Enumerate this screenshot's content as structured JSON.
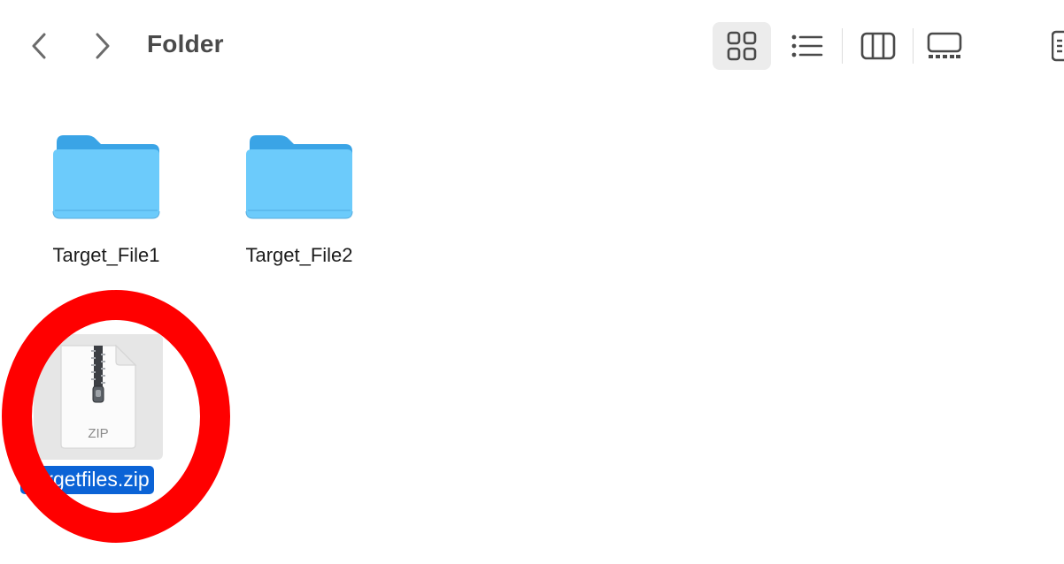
{
  "window": {
    "title": "Folder"
  },
  "toolbar": {
    "back_icon": "chevron-left-icon",
    "forward_icon": "chevron-right-icon",
    "view_modes": [
      {
        "name": "icons",
        "icon": "icon-grid-icon",
        "selected": true
      },
      {
        "name": "list",
        "icon": "list-icon",
        "selected": false
      },
      {
        "name": "columns",
        "icon": "columns-icon",
        "selected": false
      },
      {
        "name": "gallery",
        "icon": "gallery-icon",
        "selected": false
      }
    ]
  },
  "items": [
    {
      "name": "Target_File1",
      "kind": "folder",
      "icon": "folder-icon",
      "selected": false
    },
    {
      "name": "Target_File2",
      "kind": "folder",
      "icon": "folder-icon",
      "selected": false
    },
    {
      "name": "Targetfiles.zip",
      "kind": "zip",
      "icon": "zip-archive-icon",
      "badge": "ZIP",
      "selected": true
    }
  ],
  "colors": {
    "selection": "#0b63d6",
    "folder_body": "#6ccbfb",
    "folder_tab": "#3aa4e6",
    "annotation": "#ff0000"
  }
}
